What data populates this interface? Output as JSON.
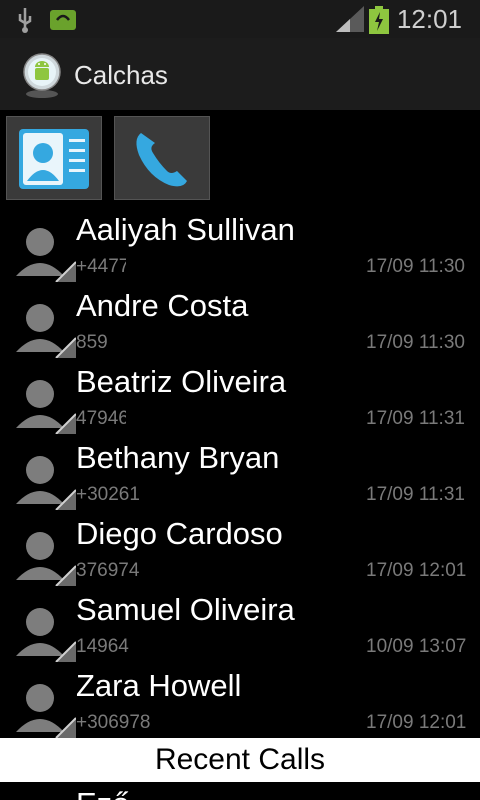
{
  "status_bar": {
    "time": "12:01"
  },
  "header": {
    "title": "Calchas"
  },
  "toolbar": {
    "contacts_icon": "contact-card-icon",
    "phone_icon": "phone-handset-icon"
  },
  "contacts": [
    {
      "name": "Aaliyah Sullivan",
      "number": "+4477",
      "time": "17/09 11:30"
    },
    {
      "name": "Andre Costa",
      "number": "8593",
      "time": "17/09 11:30"
    },
    {
      "name": "Beatriz Oliveira",
      "number": "47946",
      "time": "17/09 11:31"
    },
    {
      "name": "Bethany Bryan",
      "number": "+30261",
      "time": "17/09 11:31"
    },
    {
      "name": "Diego Cardoso",
      "number": "376974",
      "time": "17/09 12:01"
    },
    {
      "name": "Samuel Oliveira",
      "number": "14964",
      "time": "10/09 13:07"
    },
    {
      "name": "Zara Howell",
      "number": "+306978",
      "time": "17/09 12:01"
    }
  ],
  "footer": {
    "label": "Recent Calls"
  },
  "peek": {
    "name": "Ező"
  }
}
